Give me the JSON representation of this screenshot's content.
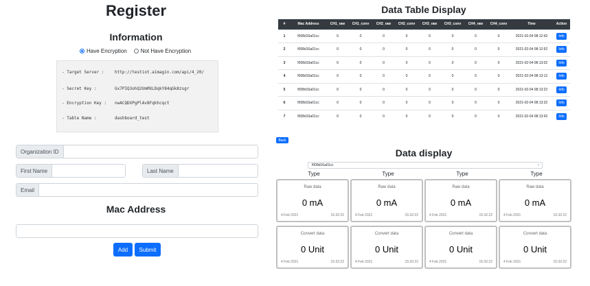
{
  "register": {
    "title": "Register",
    "info_title": "Information",
    "encryption": {
      "option_on": "Have Encryption",
      "option_off": "Not Have Encryption",
      "selected": "Have Encryption"
    },
    "code_lines": [
      {
        "key": "- Target Server :",
        "value": "http://testiot.aimagin.com/api/4_20/"
      },
      {
        "key": "- Secret Key :",
        "value": "Gx7PIQ3ohQ2UmMXLDqkY84qGk8zsgr"
      },
      {
        "key": "- Encryption Key :",
        "value": "nwACQDXPgPlAv8Fqkhcqct"
      },
      {
        "key": "- Table Name :",
        "value": "dashboard_test"
      }
    ],
    "labels": {
      "org_id": "Organization ID",
      "first_name": "First Name",
      "last_name": "Last Name",
      "email": "Email"
    },
    "mac_title": "Mac Address",
    "add_label": "Add",
    "submit_label": "Submit"
  },
  "table": {
    "title": "Data Table Display",
    "headers": [
      "#",
      "Mac Address",
      "CH1_raw",
      "CH1_conv",
      "CH2_raw",
      "CH2_conv",
      "CH3_raw",
      "CH3_conv",
      "CH4_raw",
      "CH4_conv",
      "Time",
      "Action"
    ],
    "rows": [
      [
        "1",
        "f008d16a01cc",
        "0",
        "0",
        "0",
        "0",
        "0",
        "0",
        "0",
        "0",
        "2021-02-04 08:12:42",
        "Info"
      ],
      [
        "2",
        "f008d16a01cc",
        "0",
        "0",
        "0",
        "0",
        "0",
        "0",
        "0",
        "0",
        "2021-02-04 08:12:52",
        "Info"
      ],
      [
        "3",
        "f008d16a01cc",
        "0",
        "0",
        "0",
        "0",
        "0",
        "0",
        "0",
        "0",
        "2021-02-04 08:13:02",
        "Info"
      ],
      [
        "4",
        "f008d16a01cc",
        "0",
        "0",
        "0",
        "0",
        "0",
        "0",
        "0",
        "0",
        "2021-02-04 08:13:12",
        "Info"
      ],
      [
        "5",
        "f008d16a01cc",
        "0",
        "0",
        "0",
        "0",
        "0",
        "0",
        "0",
        "0",
        "2021-02-04 08:13:22",
        "Info"
      ],
      [
        "6",
        "f008d16a01cc",
        "0",
        "0",
        "0",
        "0",
        "0",
        "0",
        "0",
        "0",
        "2021-02-04 08:13:32",
        "Info"
      ],
      [
        "7",
        "f008d16a01cc",
        "0",
        "0",
        "0",
        "0",
        "0",
        "0",
        "0",
        "0",
        "2021-02-04 08:13:42",
        "Info"
      ]
    ]
  },
  "display": {
    "back_label": "Back",
    "title": "Data display",
    "selected_mac": "f008d16a01cc",
    "type_label": "Type",
    "raw_cards": [
      {
        "title": "Raw data",
        "value": "0 mA",
        "date": "4 Feb 2021",
        "time": "15:32:22"
      },
      {
        "title": "Raw data",
        "value": "0 mA",
        "date": "4 Feb 2021",
        "time": "15:32:22"
      },
      {
        "title": "Raw data",
        "value": "0 mA",
        "date": "4 Feb 2021",
        "time": "15:32:22"
      },
      {
        "title": "Raw data",
        "value": "0 mA",
        "date": "4 Feb 2021",
        "time": "15:32:22"
      }
    ],
    "conv_cards": [
      {
        "title": "Convert data",
        "value": "0 Unit",
        "date": "4 Feb 2021",
        "time": "15:32:22"
      },
      {
        "title": "Convert data",
        "value": "0 Unit",
        "date": "4 Feb 2021",
        "time": "15:32:22"
      },
      {
        "title": "Convert data",
        "value": "0 Unit",
        "date": "4 Feb 2021",
        "time": "15:32:22"
      },
      {
        "title": "Convert data",
        "value": "0 Unit",
        "date": "4 Feb 2021",
        "time": "15:32:22"
      }
    ]
  },
  "colors": {
    "primary": "#0d6efd",
    "table_header": "#343a40",
    "code_bg": "#f2f2f2",
    "input_addon": "#e9ecef"
  }
}
